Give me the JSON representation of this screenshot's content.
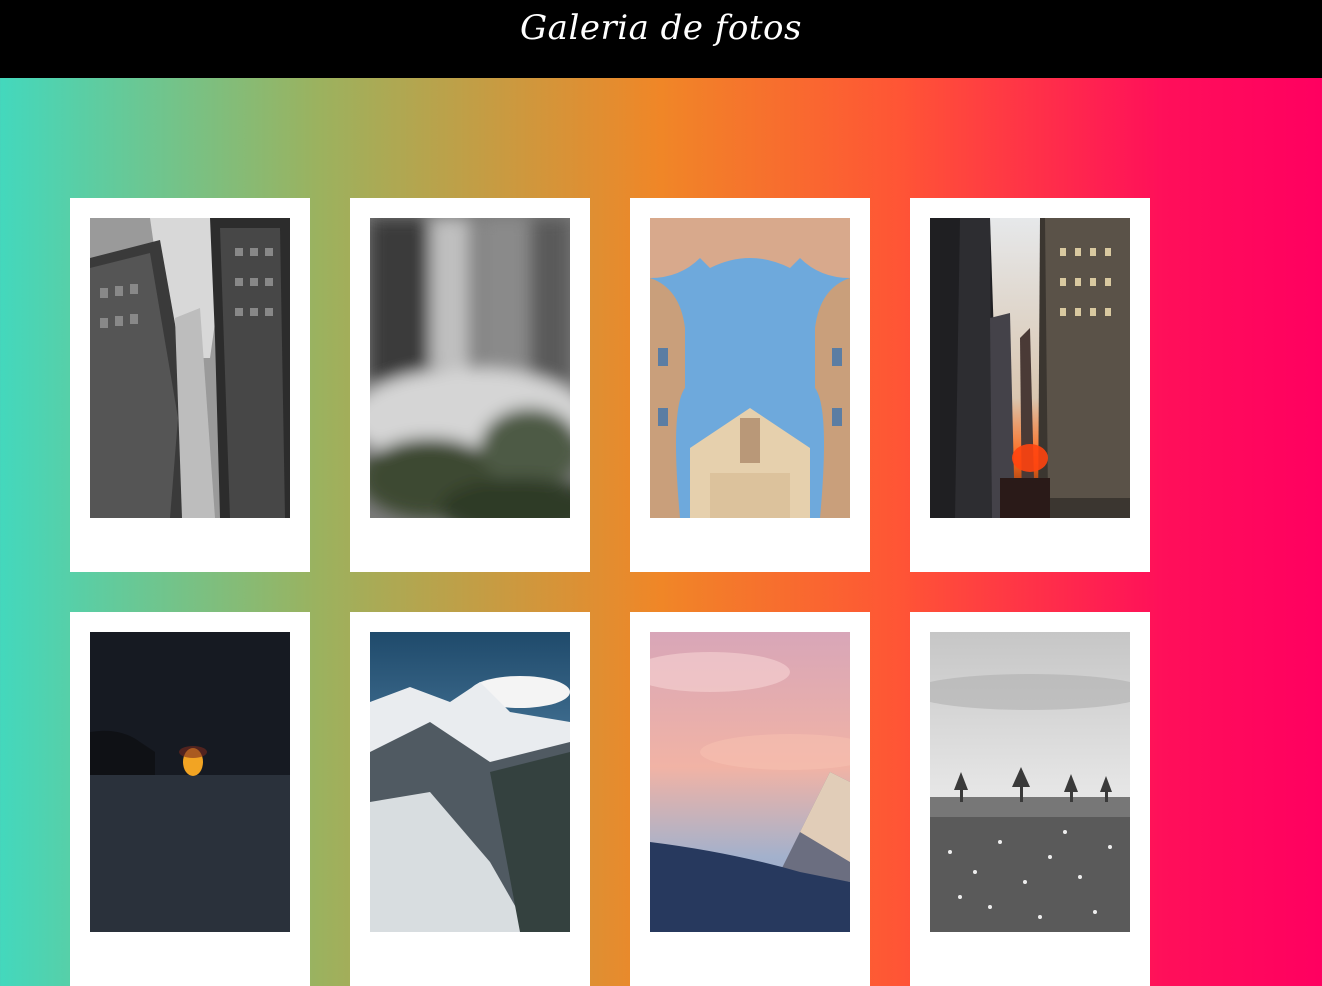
{
  "header": {
    "title": "Galeria de fotos"
  },
  "colors": {
    "header_background": "#000000",
    "gradient_start": "#43d8bd",
    "gradient_mid": "#f08627",
    "gradient_end": "#ff0060",
    "card_background": "#ffffff"
  },
  "gallery": {
    "photos": [
      {
        "subject": "grayscale skyscrapers looking up"
      },
      {
        "subject": "blurred grayscale scene"
      },
      {
        "subject": "baroque building facade against blue sky"
      },
      {
        "subject": "city street at sunset between skyscrapers"
      },
      {
        "subject": "orange moon over dark sea"
      },
      {
        "subject": "snowy mountain range"
      },
      {
        "subject": "pink sky above snowy peak"
      },
      {
        "subject": "grayscale meadow with trees and cloudy sky"
      }
    ]
  }
}
